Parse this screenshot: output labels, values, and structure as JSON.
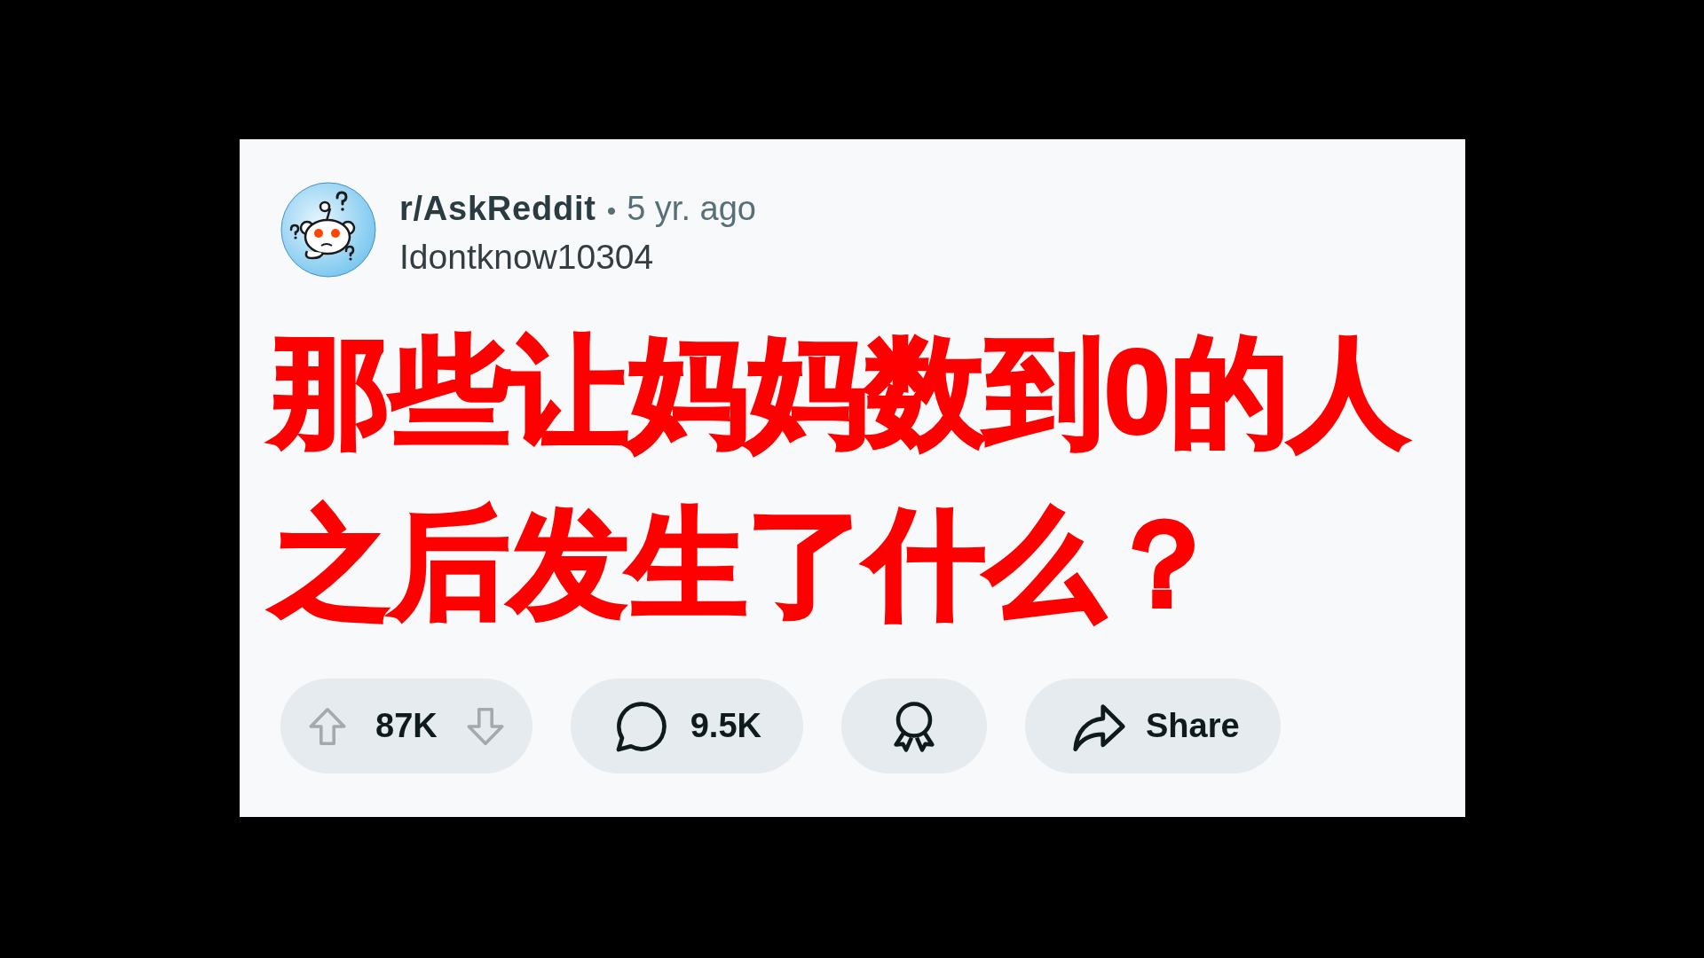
{
  "post": {
    "subreddit": "r/AskReddit",
    "separator": "•",
    "time": "5 yr. ago",
    "author": "Idontknow10304",
    "title": "那些让妈妈数到0的人之后发生了什么？"
  },
  "actions": {
    "score": "87K",
    "comments": "9.5K",
    "share": "Share"
  }
}
